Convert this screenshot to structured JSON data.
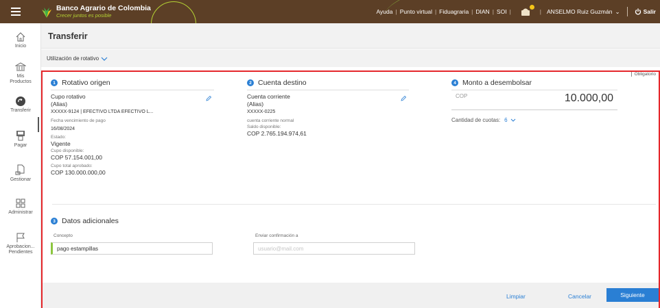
{
  "header": {
    "brand": "Banco Agrario de Colombia",
    "slogan": "Crecer juntos es posible",
    "links": [
      "Ayuda",
      "Punto virtual",
      "Fiduagraria",
      "DIAN",
      "SOI"
    ],
    "user": "ANSELMO Ruiz Guzmán",
    "logout": "Salir"
  },
  "sidebar": {
    "items": [
      {
        "label": "Inicio",
        "icon": "home-icon"
      },
      {
        "label": "Mis Productos",
        "icon": "bank-icon"
      },
      {
        "label": "Transferir",
        "icon": "transfer-icon"
      },
      {
        "label": "Pagar",
        "icon": "pay-icon"
      },
      {
        "label": "Gestionar",
        "icon": "manage-icon"
      },
      {
        "label": "Administrar",
        "icon": "grid-icon"
      },
      {
        "label": "Aprobacion... Pendientes",
        "icon": "flag-icon"
      }
    ]
  },
  "page": {
    "title": "Transferir",
    "subtitle": "Utilización de rotativo"
  },
  "form": {
    "obligatorio": "Obligatorio",
    "origen": {
      "num": "1",
      "title": "Rotativo origen",
      "type": "Cupo rotativo",
      "alias": "(Alias)",
      "account": "XXXXX-9124 | EFECTIVO LTDA EFECTIVO L...",
      "due_label": "Fecha vencimiento de pago",
      "due_value": "16/08/2024",
      "state_label": "Estado:",
      "state_value": "Vigente",
      "avail_label": "Cupo disponible:",
      "avail_value": "COP 57.154.001,00",
      "total_label": "Cupo total aprobado:",
      "total_value": "COP 130.000.000,00"
    },
    "destino": {
      "num": "2",
      "title": "Cuenta destino",
      "type": "Cuenta corriente",
      "alias": "(Alias)",
      "account": "XXXXX-0225",
      "status": "cuenta corriente normal",
      "balance_label": "Saldo disponible:",
      "balance_value": "COP 2.765.194.974,61"
    },
    "monto": {
      "num": "4",
      "title": "Monto a desembolsar",
      "currency": "COP",
      "amount": "10.000,00",
      "cuotas_label": "Cantidad de cuotas:",
      "cuotas_value": "6"
    },
    "datos": {
      "num": "3",
      "title": "Datos adicionales",
      "concepto_label": "Concepto",
      "concepto_value": "pago estampillas",
      "email_label": "Enviar confirmación a",
      "email_placeholder": "usuario@mail.com"
    },
    "buttons": {
      "clear": "Limpiar",
      "cancel": "Cancelar",
      "next": "Siguiente"
    }
  },
  "colors": {
    "topbar": "#5c3f26",
    "accent": "#2a7fd4",
    "highlight_border": "#e5262a",
    "brand_green": "#8cc63f"
  }
}
